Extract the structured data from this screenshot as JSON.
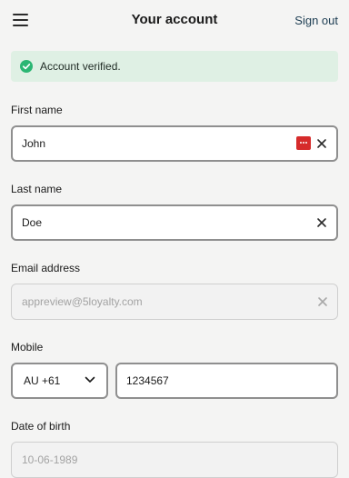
{
  "header": {
    "title": "Your account",
    "sign_out": "Sign out"
  },
  "alert": {
    "message": "Account verified."
  },
  "form": {
    "first_name": {
      "label": "First name",
      "value": "John"
    },
    "last_name": {
      "label": "Last name",
      "value": "Doe"
    },
    "email": {
      "label": "Email address",
      "value": "appreview@5loyalty.com"
    },
    "mobile": {
      "label": "Mobile",
      "country_code": "AU +61",
      "number": "1234567"
    },
    "dob": {
      "label": "Date of birth",
      "value": "10-06-1989"
    }
  },
  "icons": {
    "menu": "hamburger-icon",
    "alert": "check-circle-icon",
    "password_manager": "password-manager-icon",
    "clear": "close-icon",
    "dropdown": "chevron-down-icon"
  },
  "colors": {
    "background": "#f4f4f3",
    "success_bg": "#dff0e4",
    "success_icon": "#2bb673",
    "link": "#1d3d52",
    "field_border": "#8f8f8f",
    "password_icon": "#d62b2b"
  }
}
